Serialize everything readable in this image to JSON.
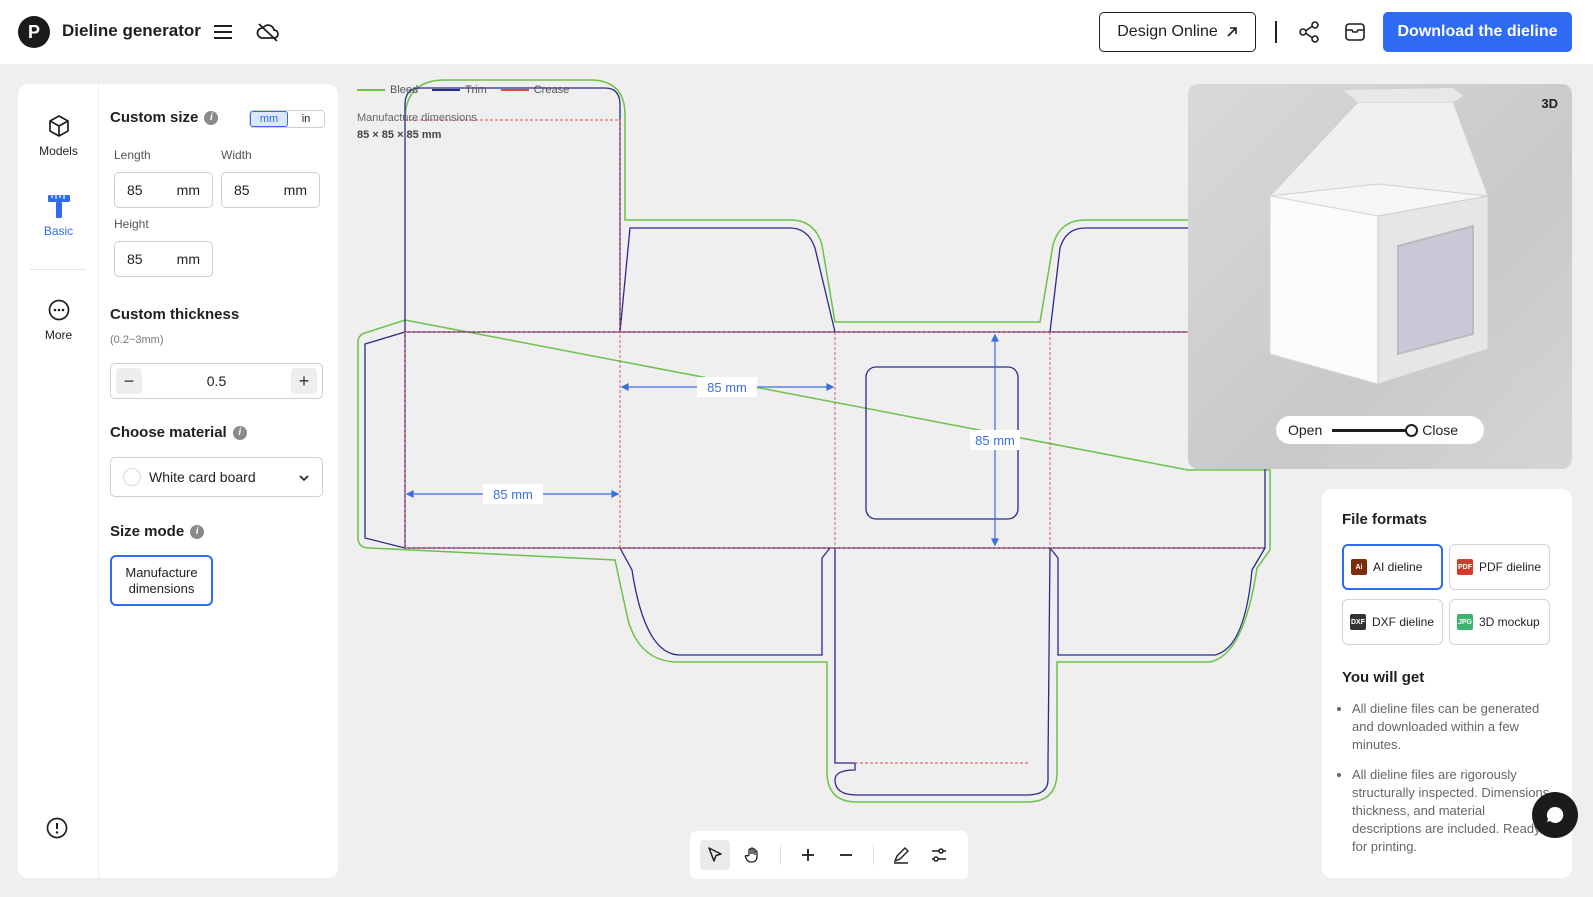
{
  "header": {
    "title": "Dieline generator",
    "design_online": "Design Online",
    "download": "Download the dieline",
    "icons": [
      "menu-icon",
      "cloud-off-icon",
      "share-icon",
      "archive-icon"
    ]
  },
  "rail": {
    "items": [
      {
        "label": "Models",
        "icon": "cube-icon"
      },
      {
        "label": "Basic",
        "icon": "ruler-icon",
        "active": true
      },
      {
        "label": "More",
        "icon": "more-icon"
      }
    ]
  },
  "size": {
    "title": "Custom size",
    "unit_mm": "mm",
    "unit_in": "in",
    "length_label": "Length",
    "width_label": "Width",
    "height_label": "Height",
    "length": "85",
    "width": "85",
    "height": "85",
    "unit": "mm"
  },
  "thickness": {
    "title": "Custom thickness",
    "range": "(0.2~3mm)",
    "value": "0.5",
    "minus": "−",
    "plus": "+"
  },
  "material": {
    "title": "Choose material",
    "selected": "White card board"
  },
  "size_mode": {
    "title": "Size mode",
    "option": "Manufacture dimensions"
  },
  "legend": {
    "bleed": "Bleed",
    "trim": "Trim",
    "crease": "Crease",
    "colors": {
      "bleed": "#5cb83a",
      "trim": "#2b2a8a",
      "crease": "#e04848"
    }
  },
  "dimensions": {
    "label": "Manufacture dimensions",
    "value": "85 × 85 × 85 mm",
    "width_tag": "85 mm",
    "length_tag": "85 mm",
    "height_tag": "85 mm"
  },
  "preview": {
    "badge": "3D",
    "open": "Open",
    "close": "Close",
    "slider_value": 1.0
  },
  "formats": {
    "title": "File formats",
    "items": [
      {
        "label": "AI dieline",
        "icon_text": "Ai",
        "color": "#7a2c0b",
        "selected": true
      },
      {
        "label": "PDF dieline",
        "icon_text": "PDF",
        "color": "#d9372b"
      },
      {
        "label": "DXF dieline",
        "icon_text": "DXF",
        "color": "#333333"
      },
      {
        "label": "3D mockup",
        "icon_text": "JPG",
        "color": "#3bb36a"
      }
    ]
  },
  "you_get": {
    "title": "You will get",
    "bullets": [
      "All dieline files can be generated and downloaded within a few minutes.",
      "All dieline files are rigorously structurally inspected. Dimensions, thickness, and material descriptions are included. Ready for printing."
    ]
  },
  "accent": "#2f6bf2"
}
